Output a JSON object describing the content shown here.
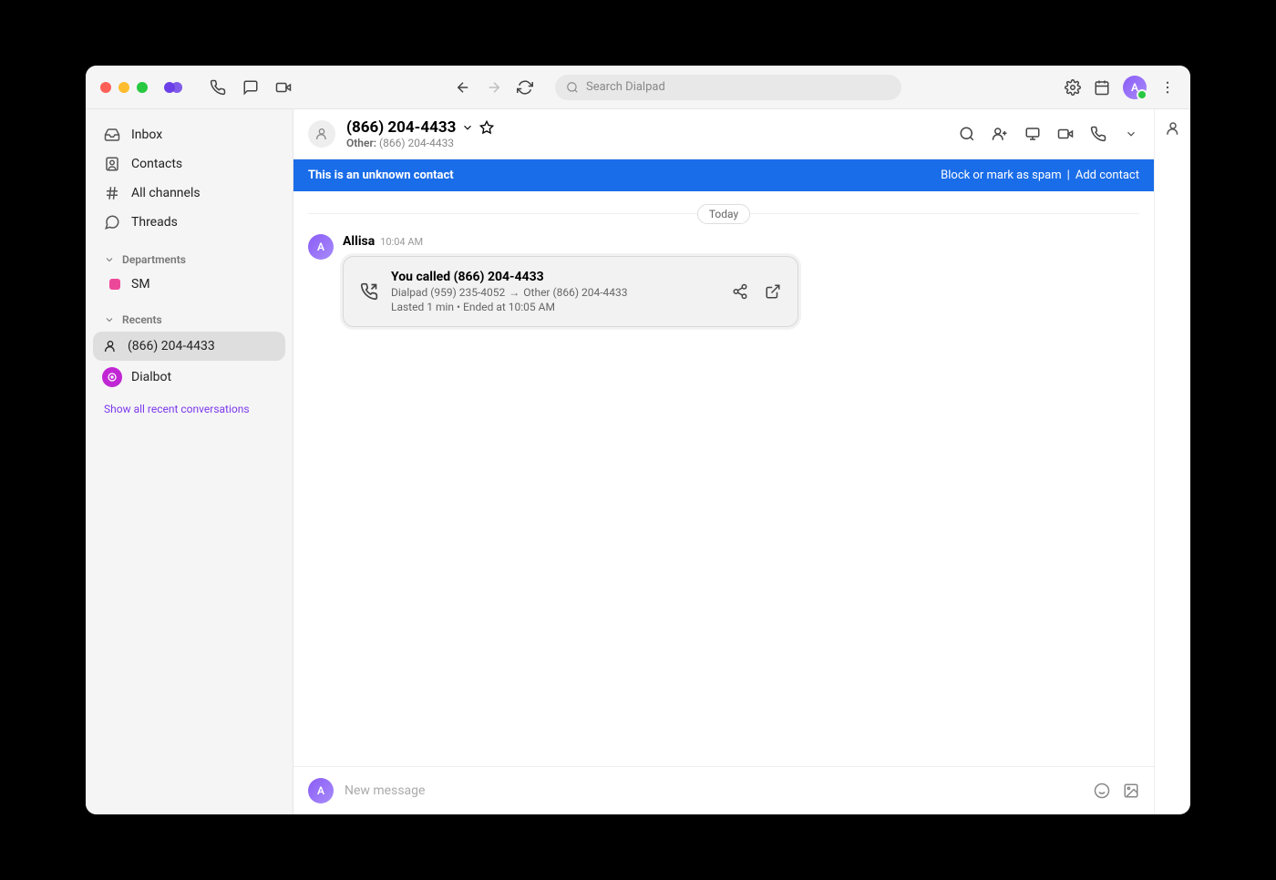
{
  "search": {
    "placeholder": "Search Dialpad"
  },
  "sidebar": {
    "nav": [
      {
        "label": "Inbox"
      },
      {
        "label": "Contacts"
      },
      {
        "label": "All channels"
      },
      {
        "label": "Threads"
      }
    ],
    "departments_label": "Departments",
    "departments": [
      {
        "label": "SM",
        "color": "#ec4899"
      }
    ],
    "recents_label": "Recents",
    "recents": [
      {
        "label": "(866) 204-4433",
        "active": true
      },
      {
        "label": "Dialbot"
      }
    ],
    "show_all": "Show all recent conversations"
  },
  "conversation": {
    "title": "(866) 204-4433",
    "sub_label": "Other:",
    "sub_value": "(866) 204-4433",
    "banner_text": "This is an unknown contact",
    "banner_action_block": "Block or mark as spam",
    "banner_sep": "|",
    "banner_action_add": "Add contact",
    "date_divider": "Today",
    "message": {
      "author": "Allisa",
      "avatar_letter": "A",
      "time": "10:04 AM",
      "call_title": "You called (866) 204-4433",
      "call_from": "Dialpad (959) 235-4052",
      "call_arrow": "→",
      "call_to": "Other (866) 204-4433",
      "call_meta": "Lasted 1 min • Ended at 10:05 AM"
    },
    "composer_placeholder": "New message",
    "avatar_letter": "A"
  }
}
